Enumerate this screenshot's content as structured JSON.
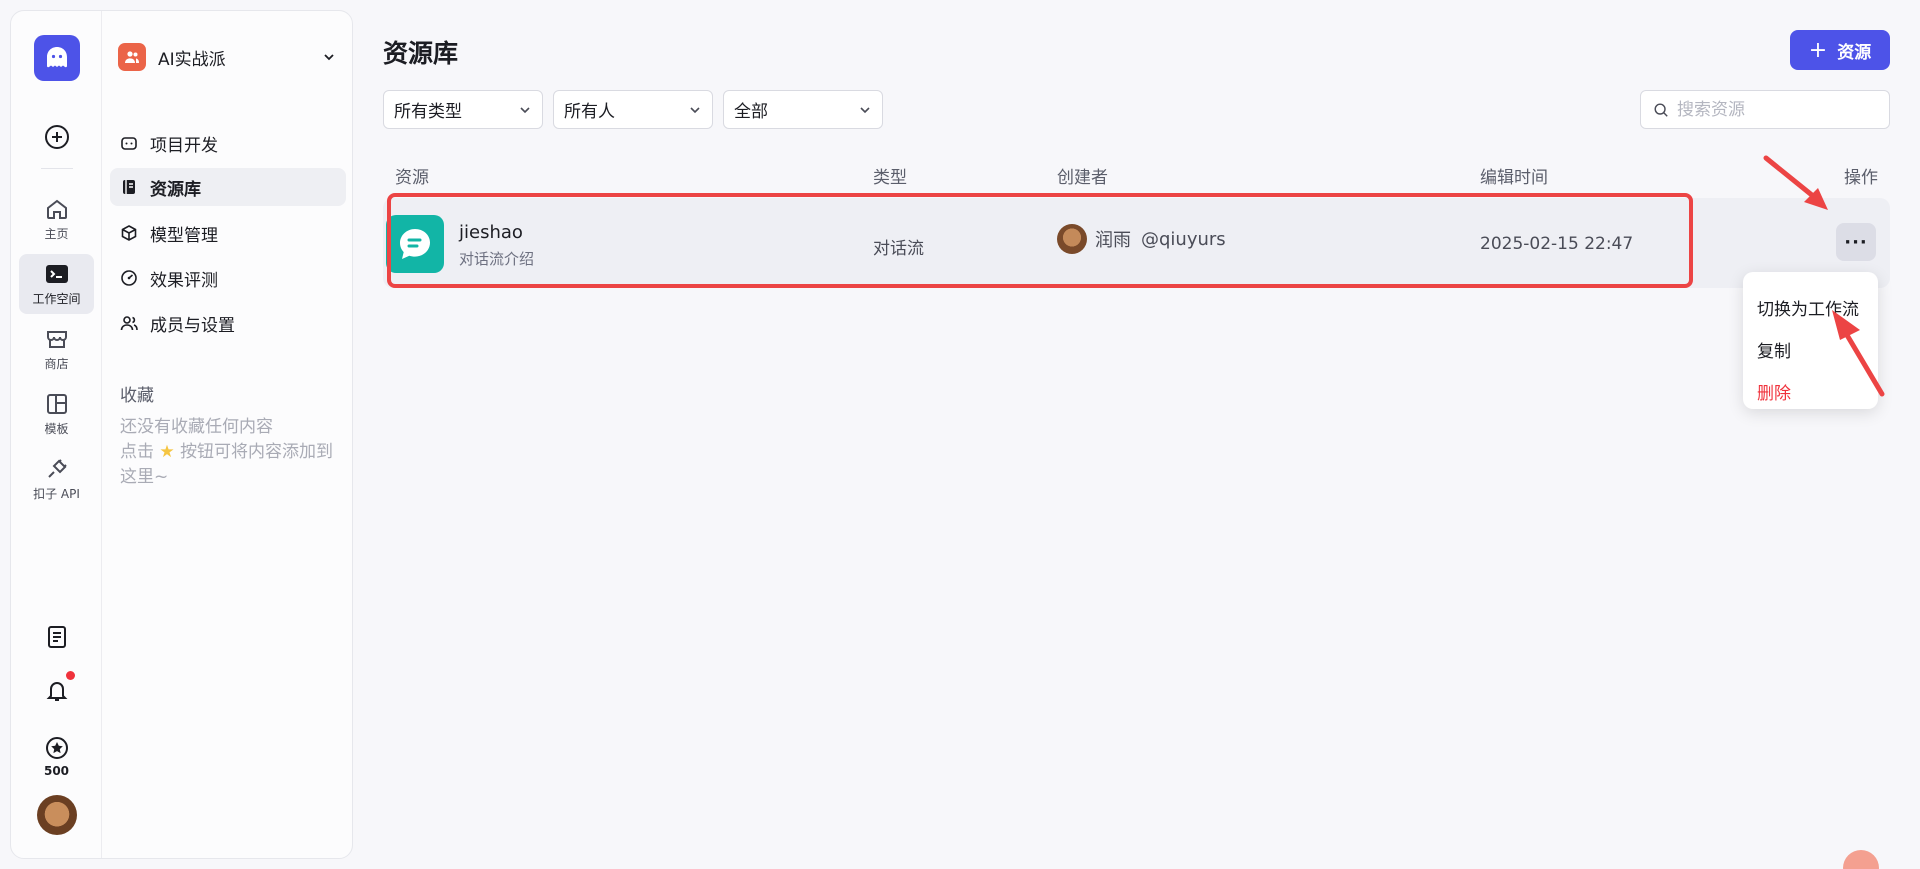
{
  "rail": {
    "items": [
      {
        "label": "主页"
      },
      {
        "label": "工作空间"
      },
      {
        "label": "商店"
      },
      {
        "label": "模板"
      },
      {
        "label": "扣子 API"
      }
    ],
    "credits": "500"
  },
  "sidebar": {
    "team_name": "AI实战派",
    "nav": [
      {
        "label": "项目开发"
      },
      {
        "label": "资源库"
      },
      {
        "label": "模型管理"
      },
      {
        "label": "效果评测"
      },
      {
        "label": "成员与设置"
      }
    ],
    "favorites_title": "收藏",
    "favorites_empty_line1": "还没有收藏任何内容",
    "favorites_empty_line2_prefix": "点击",
    "favorites_empty_line2_suffix": "按钮可将内容添加到这里~"
  },
  "main": {
    "title": "资源库",
    "add_button": "资源",
    "filters": {
      "type": "所有类型",
      "owner": "所有人",
      "status": "全部"
    },
    "search_placeholder": "搜索资源",
    "columns": {
      "resource": "资源",
      "type": "类型",
      "creator": "创建者",
      "edit_time": "编辑时间",
      "actions": "操作"
    },
    "rows": [
      {
        "name": "jieshao",
        "desc": "对话流介绍",
        "type": "对话流",
        "creator_name": "润雨",
        "creator_handle": "@qiuyurs",
        "edit_time": "2025-02-15 22:47"
      }
    ],
    "menu": [
      {
        "label": "切换为工作流"
      },
      {
        "label": "复制"
      },
      {
        "label": "删除"
      }
    ]
  },
  "colors": {
    "brand": "#4d53e8",
    "resource_icon": "#12b5a6",
    "danger": "#f0323c",
    "highlight": "#ec4444"
  }
}
